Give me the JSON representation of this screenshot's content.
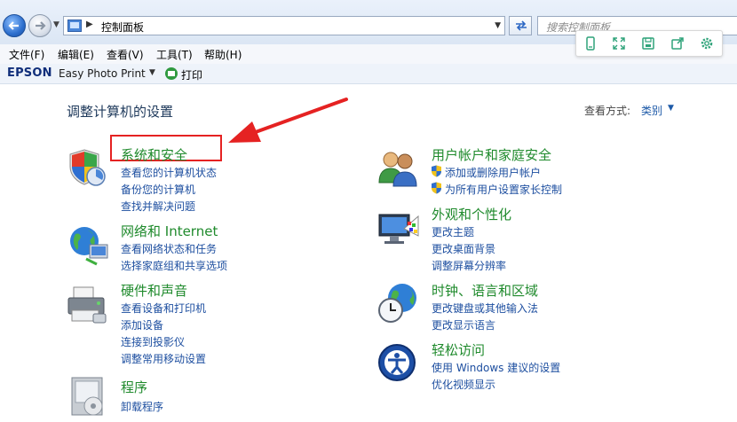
{
  "address_bar": {
    "path_label": "控制面板",
    "search_placeholder": "搜索控制面板"
  },
  "menu": [
    {
      "label": "文件(F)"
    },
    {
      "label": "编辑(E)"
    },
    {
      "label": "查看(V)"
    },
    {
      "label": "工具(T)"
    },
    {
      "label": "帮助(H)"
    }
  ],
  "epson_bar": {
    "logo": "EPSON",
    "app": "Easy Photo Print",
    "print": "打印"
  },
  "page": {
    "title": "调整计算机的设置",
    "view_by_label": "查看方式:",
    "view_by_value": "类别"
  },
  "categories": [
    {
      "title": "系统和安全",
      "links": [
        "查看您的计算机状态",
        "备份您的计算机",
        "查找并解决问题"
      ]
    },
    {
      "title": "网络和 Internet",
      "links": [
        "查看网络状态和任务",
        "选择家庭组和共享选项"
      ]
    },
    {
      "title": "硬件和声音",
      "links": [
        "查看设备和打印机",
        "添加设备",
        "连接到投影仪",
        "调整常用移动设置"
      ]
    },
    {
      "title": "程序",
      "links": [
        "卸载程序"
      ]
    },
    {
      "title": "用户帐户和家庭安全",
      "links": [
        "添加或删除用户帐户",
        "为所有用户设置家长控制"
      ]
    },
    {
      "title": "外观和个性化",
      "links": [
        "更改主题",
        "更改桌面背景",
        "调整屏幕分辨率"
      ]
    },
    {
      "title": "时钟、语言和区域",
      "links": [
        "更改键盘或其他输入法",
        "更改显示语言"
      ]
    },
    {
      "title": "轻松访问",
      "links": [
        "使用 Windows 建议的设置",
        "优化视频显示"
      ]
    }
  ],
  "colors": {
    "category_title": "#1f8a2c",
    "link": "#1e4fa0",
    "annotation": "#e52222"
  },
  "icons": [
    "back-arrow-icon",
    "forward-arrow-icon",
    "refresh-icon",
    "shield-icon",
    "users-icon",
    "network-globe-icon",
    "monitor-palette-icon",
    "printer-icon",
    "clock-globe-icon",
    "programs-box-icon",
    "accessibility-icon"
  ]
}
